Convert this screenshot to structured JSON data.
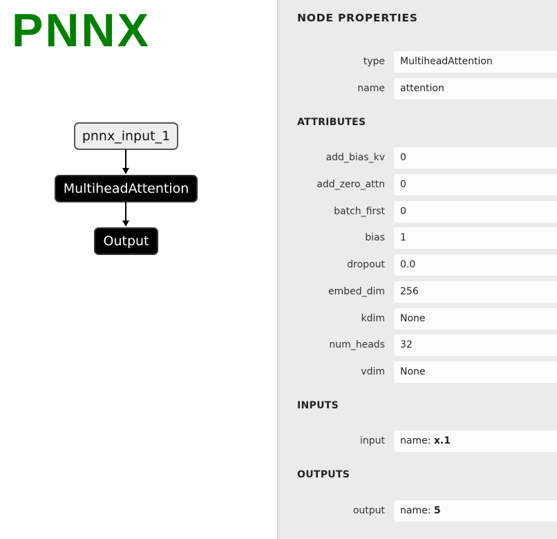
{
  "logo": "PNNX",
  "graph": {
    "nodes": [
      {
        "label": "pnnx_input_1",
        "kind": "input"
      },
      {
        "label": "MultiheadAttention",
        "kind": "operator"
      },
      {
        "label": "Output",
        "kind": "operator"
      }
    ]
  },
  "panel": {
    "title": "NODE PROPERTIES",
    "properties": [
      {
        "label": "type",
        "value": "MultiheadAttention"
      },
      {
        "label": "name",
        "value": "attention"
      }
    ],
    "attributes_title": "ATTRIBUTES",
    "attributes": [
      {
        "label": "add_bias_kv",
        "value": "0"
      },
      {
        "label": "add_zero_attn",
        "value": "0"
      },
      {
        "label": "batch_first",
        "value": "0"
      },
      {
        "label": "bias",
        "value": "1"
      },
      {
        "label": "dropout",
        "value": "0.0"
      },
      {
        "label": "embed_dim",
        "value": "256"
      },
      {
        "label": "kdim",
        "value": "None"
      },
      {
        "label": "num_heads",
        "value": "32"
      },
      {
        "label": "vdim",
        "value": "None"
      }
    ],
    "inputs_title": "INPUTS",
    "inputs": [
      {
        "label": "input",
        "prefix": "name: ",
        "value": "x.1"
      }
    ],
    "outputs_title": "OUTPUTS",
    "outputs": [
      {
        "label": "output",
        "prefix": "name: ",
        "value": "5"
      }
    ]
  },
  "colors": {
    "logo": "#008000",
    "panel_bg": "#ebebeb",
    "value_bg": "#fcfcfc"
  }
}
